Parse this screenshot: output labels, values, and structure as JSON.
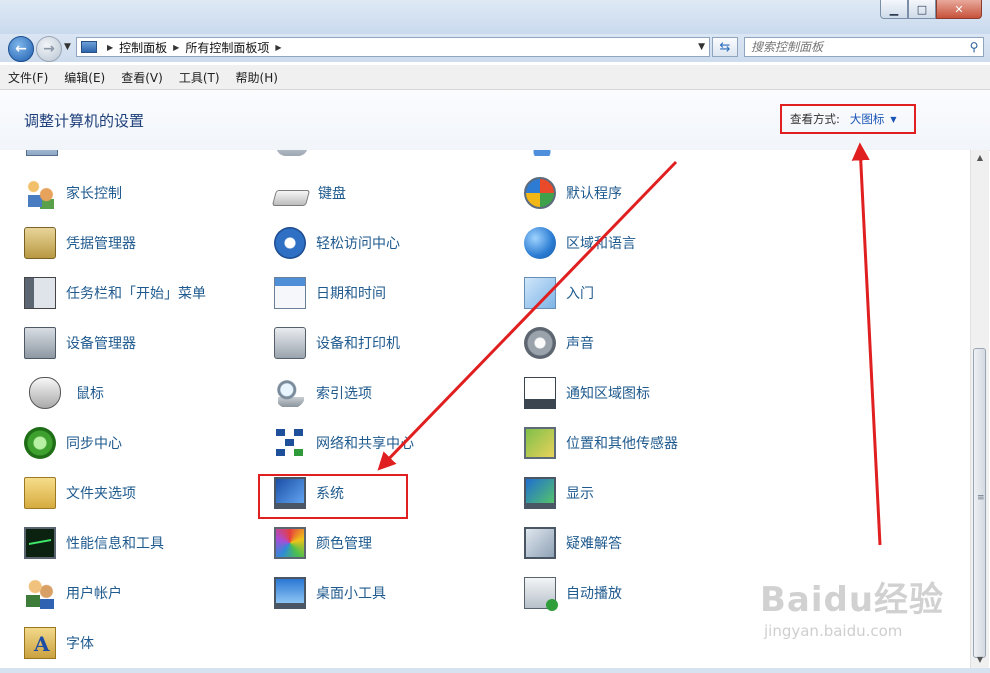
{
  "window": {
    "controls": {
      "minimize": "▁",
      "maximize": "□",
      "close": "✕"
    }
  },
  "navigation": {
    "back_icon": "arrow-left-icon",
    "forward_icon": "arrow-right-icon",
    "breadcrumb": [
      "控制面板",
      "所有控制面板项"
    ],
    "search_placeholder": "搜索控制面板"
  },
  "menubar": {
    "items": [
      "文件(F)",
      "编辑(E)",
      "查看(V)",
      "工具(T)",
      "帮助(H)"
    ]
  },
  "header": {
    "title": "调整计算机的设置",
    "view_by_label": "查看方式:",
    "view_by_value": "大图标"
  },
  "items": [
    {
      "label": "家长控制",
      "icon": "parental-controls-icon"
    },
    {
      "label": "键盘",
      "icon": "keyboard-icon"
    },
    {
      "label": "默认程序",
      "icon": "default-programs-icon"
    },
    {
      "label": "凭据管理器",
      "icon": "credential-manager-icon"
    },
    {
      "label": "轻松访问中心",
      "icon": "ease-of-access-icon"
    },
    {
      "label": "区域和语言",
      "icon": "region-language-icon"
    },
    {
      "label": "任务栏和「开始」菜单",
      "icon": "taskbar-start-menu-icon"
    },
    {
      "label": "日期和时间",
      "icon": "date-time-icon"
    },
    {
      "label": "入门",
      "icon": "getting-started-icon"
    },
    {
      "label": "设备管理器",
      "icon": "device-manager-icon"
    },
    {
      "label": "设备和打印机",
      "icon": "devices-printers-icon"
    },
    {
      "label": "声音",
      "icon": "sound-icon"
    },
    {
      "label": "鼠标",
      "icon": "mouse-icon"
    },
    {
      "label": "索引选项",
      "icon": "indexing-options-icon"
    },
    {
      "label": "通知区域图标",
      "icon": "notification-area-icon"
    },
    {
      "label": "同步中心",
      "icon": "sync-center-icon"
    },
    {
      "label": "网络和共享中心",
      "icon": "network-sharing-icon"
    },
    {
      "label": "位置和其他传感器",
      "icon": "location-sensors-icon"
    },
    {
      "label": "文件夹选项",
      "icon": "folder-options-icon"
    },
    {
      "label": "系统",
      "icon": "system-icon"
    },
    {
      "label": "显示",
      "icon": "display-icon"
    },
    {
      "label": "性能信息和工具",
      "icon": "performance-icon"
    },
    {
      "label": "颜色管理",
      "icon": "color-management-icon"
    },
    {
      "label": "疑难解答",
      "icon": "troubleshooting-icon"
    },
    {
      "label": "用户帐户",
      "icon": "user-accounts-icon"
    },
    {
      "label": "桌面小工具",
      "icon": "desktop-gadgets-icon"
    },
    {
      "label": "自动播放",
      "icon": "autoplay-icon"
    },
    {
      "label": "字体",
      "icon": "fonts-icon"
    }
  ],
  "annotation": {
    "highlight_color": "#e02020"
  },
  "watermark": {
    "logo": "Baidu经验",
    "url": "jingyan.baidu.com"
  }
}
